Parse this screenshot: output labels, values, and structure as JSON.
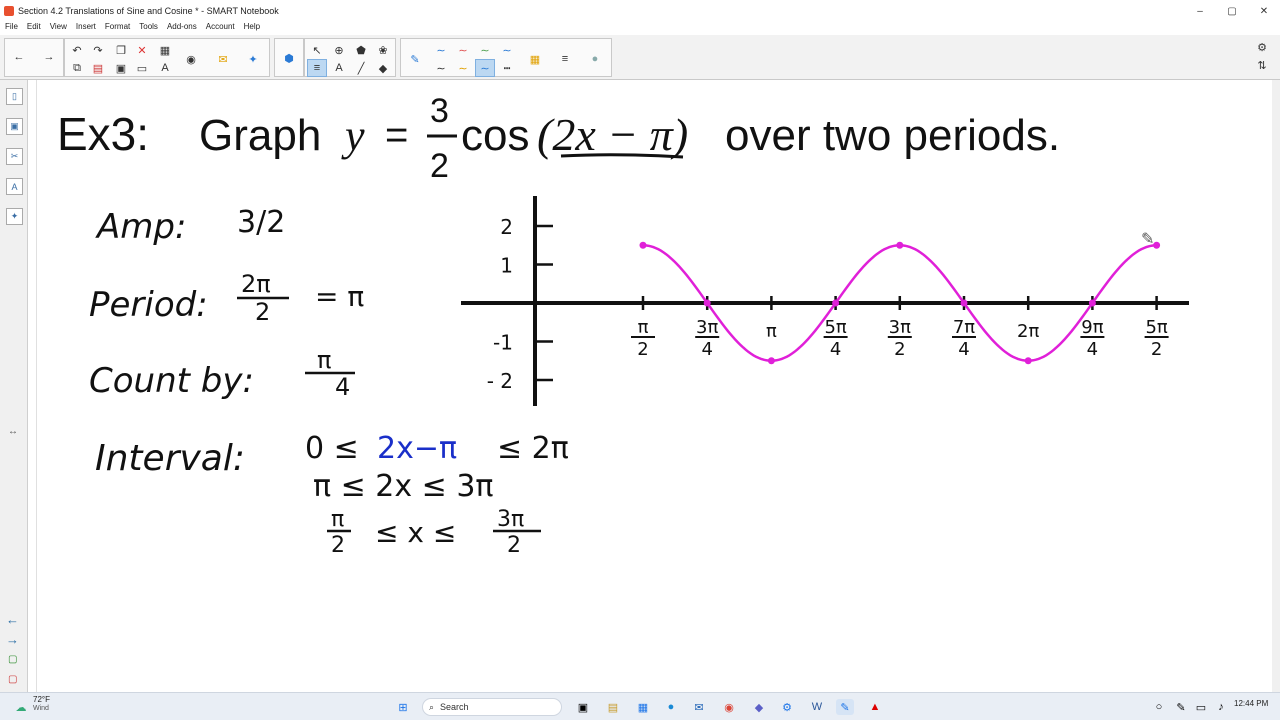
{
  "window": {
    "title": "Section 4.2 Translations of Sine and Cosine * - SMART Notebook",
    "minimize_glyph": "–",
    "maximize_glyph": "▢",
    "close_glyph": "✕"
  },
  "menu": {
    "items": [
      "File",
      "Edit",
      "View",
      "Insert",
      "Format",
      "Tools",
      "Add-ons",
      "Account",
      "Help"
    ]
  },
  "slide": {
    "heading_prefix": "Ex3:",
    "heading_graph": "Graph",
    "heading_y": "y",
    "heading_eq": "=",
    "heading_frac_num": "3",
    "heading_frac_den": "2",
    "heading_cos": "cos",
    "heading_arg": "(2x − π)",
    "heading_suffix": "over two periods.",
    "amp_label": "Amp:",
    "amp_value": "3/2",
    "period_label": "Period:",
    "period_num": "2π",
    "period_den": "2",
    "period_result": "= π",
    "count_label": "Count by:",
    "count_num": "π",
    "count_den": "4",
    "interval_label": "Interval:",
    "interval_line1_a": "0 ≤",
    "interval_line1_b": "2x−π",
    "interval_line1_c": "≤ 2π",
    "interval_line2": "π ≤ 2x ≤ 3π",
    "interval_line3_a_num": "π",
    "interval_line3_a_den": "2",
    "interval_line3_mid": "≤ x ≤",
    "interval_line3_b_num": "3π",
    "interval_line3_b_den": "2"
  },
  "chart_data": {
    "type": "line",
    "title": "",
    "xlabel": "",
    "ylabel": "",
    "y_ticks": [
      "2",
      "1",
      "-1",
      "- 2"
    ],
    "x_ticks": [
      {
        "num": "π",
        "den": "2"
      },
      {
        "num": "3π",
        "den": "4"
      },
      {
        "num": "π",
        "den": ""
      },
      {
        "num": "5π",
        "den": "4"
      },
      {
        "num": "3π",
        "den": "2"
      },
      {
        "num": "7π",
        "den": "4"
      },
      {
        "num": "2π",
        "den": ""
      },
      {
        "num": "9π",
        "den": "4"
      },
      {
        "num": "5π",
        "den": "2"
      }
    ],
    "series": [
      {
        "color": "#e020d8",
        "x": [
          1.5708,
          2.3562,
          3.1416,
          3.927,
          4.7124,
          5.4978,
          6.2832,
          7.0686,
          7.854
        ],
        "y": [
          1.5,
          0,
          -1.5,
          0,
          1.5,
          0,
          -1.5,
          0,
          1.5
        ]
      }
    ]
  },
  "taskbar": {
    "weather": "72°F",
    "weather_sub": "Wind",
    "search_placeholder": "Search",
    "time": "12:44 PM"
  }
}
